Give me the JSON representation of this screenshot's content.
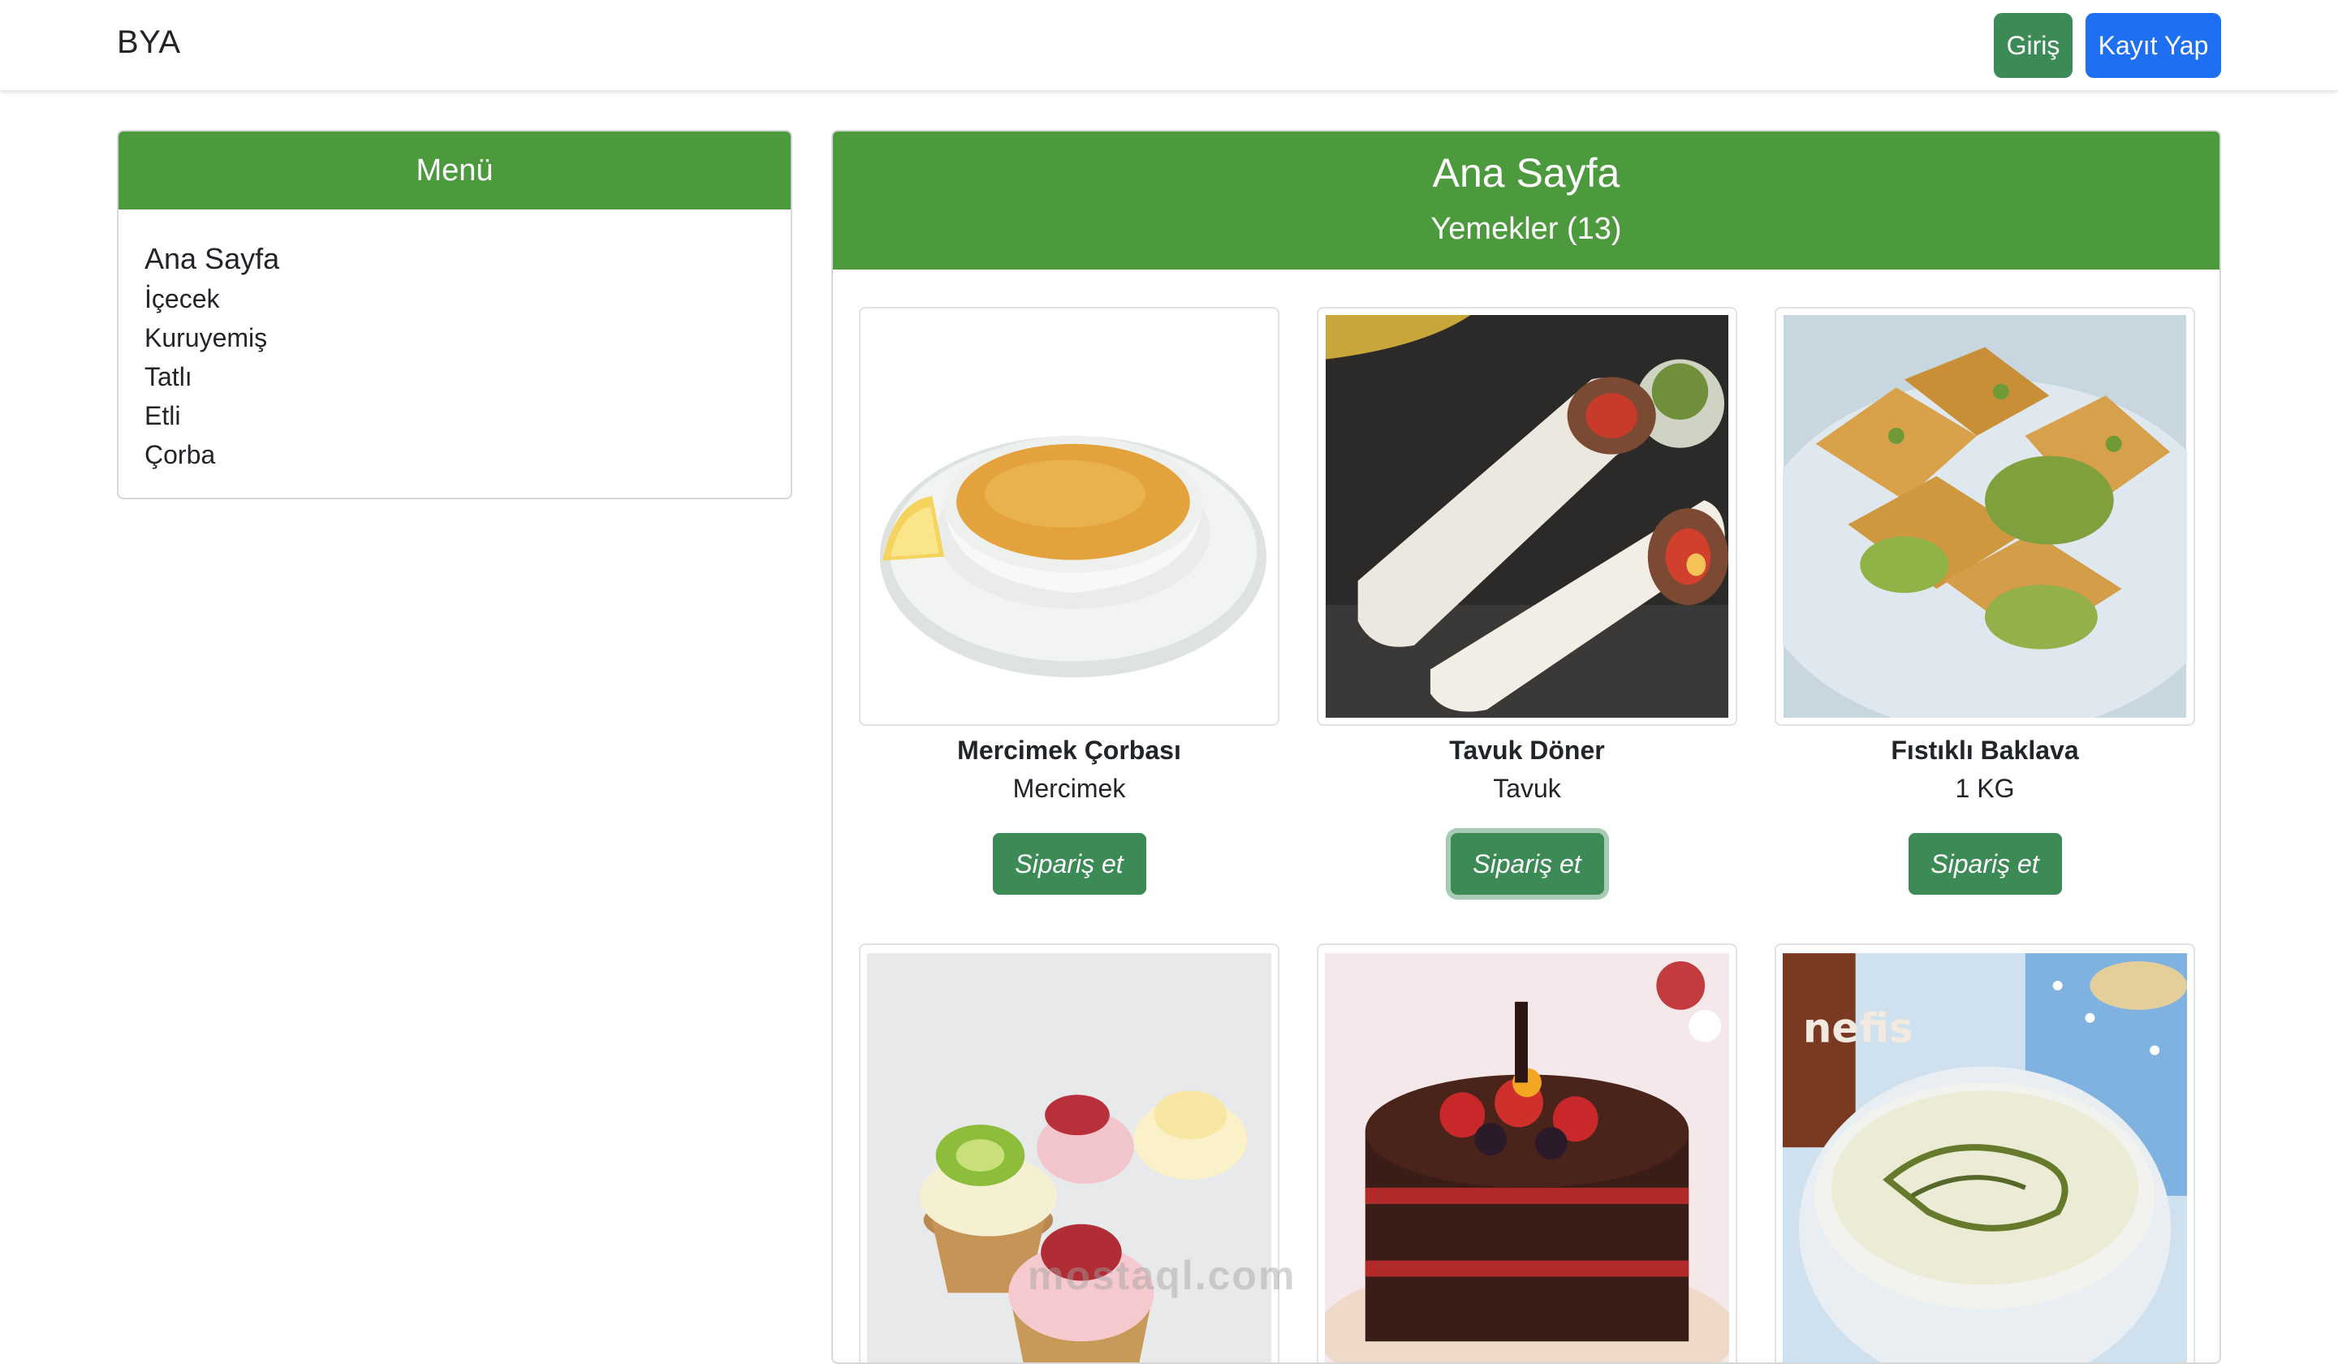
{
  "navbar": {
    "brand": "BYA",
    "login_label": "Giriş",
    "register_label": "Kayıt Yap"
  },
  "sidebar": {
    "title": "Menü",
    "items": [
      {
        "label": "Ana Sayfa"
      },
      {
        "label": "İçecek"
      },
      {
        "label": "Kuruyemiş"
      },
      {
        "label": "Tatlı"
      },
      {
        "label": "Etli"
      },
      {
        "label": "Çorba"
      }
    ]
  },
  "main": {
    "title": "Ana Sayfa",
    "subtitle": "Yemekler (13)"
  },
  "products": [
    {
      "name": "Mercimek Çorbası",
      "desc": "Mercimek",
      "button": "Sipariş et",
      "image": "lentil-soup-image"
    },
    {
      "name": "Tavuk Döner",
      "desc": "Tavuk",
      "button": "Sipariş et",
      "image": "chicken-doner-image"
    },
    {
      "name": "Fıstıklı Baklava",
      "desc": "1 KG",
      "button": "Sipariş et",
      "image": "pistachio-baklava-image"
    },
    {
      "image": "fruit-tartlets-image"
    },
    {
      "image": "chocolate-berry-cake-image"
    },
    {
      "image": "yogurt-soup-image"
    }
  ],
  "watermark": "mostaql.com",
  "colors": {
    "header_green": "#4d9a3e",
    "button_green": "#3c8b57",
    "button_blue": "#1e6ff2"
  }
}
